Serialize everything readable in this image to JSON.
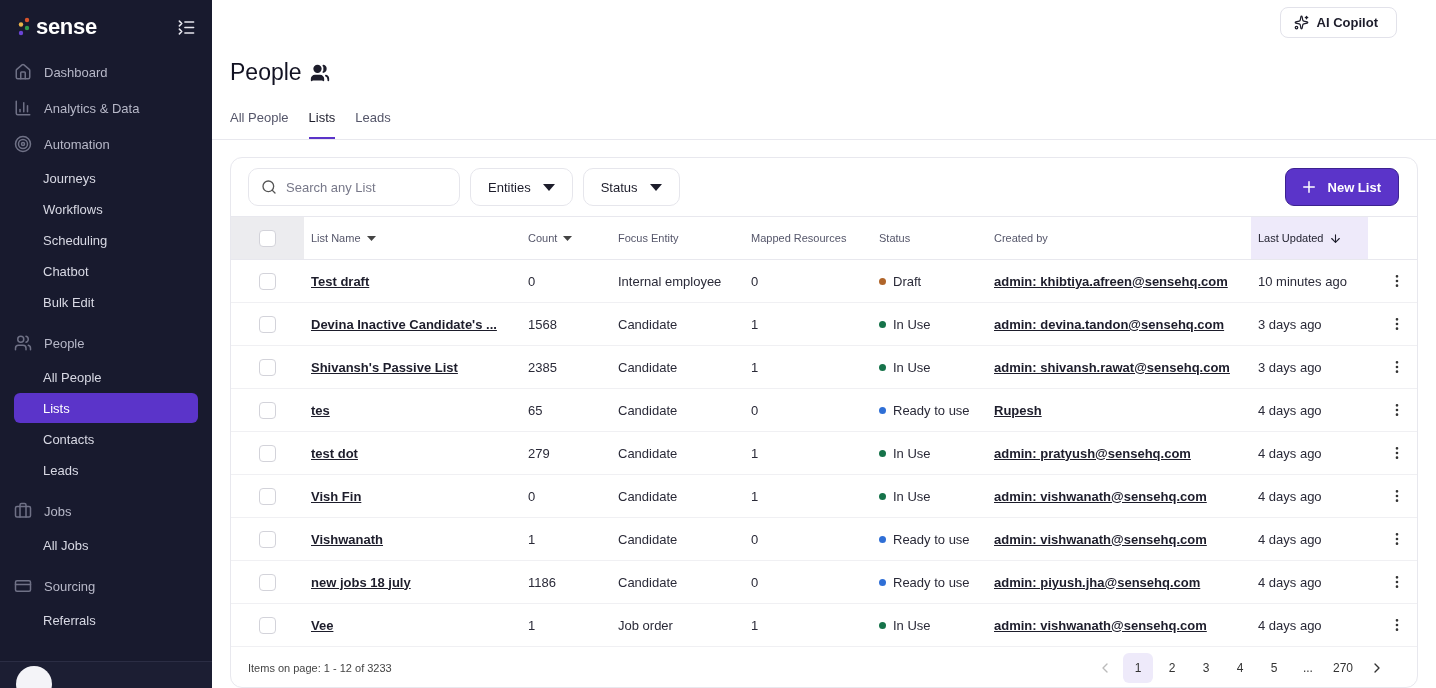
{
  "brand": {
    "name": "sense"
  },
  "sidebar": {
    "sections": [
      {
        "label": "Dashboard"
      },
      {
        "label": "Analytics & Data"
      },
      {
        "label": "Automation",
        "children": [
          {
            "label": "Journeys",
            "selected": false
          },
          {
            "label": "Workflows",
            "selected": false
          },
          {
            "label": "Scheduling",
            "selected": false
          },
          {
            "label": "Chatbot",
            "selected": false
          },
          {
            "label": "Bulk Edit",
            "selected": false
          }
        ]
      },
      {
        "label": "People",
        "children": [
          {
            "label": "All People",
            "selected": false
          },
          {
            "label": "Lists",
            "selected": true
          },
          {
            "label": "Contacts",
            "selected": false
          },
          {
            "label": "Leads",
            "selected": false
          }
        ]
      },
      {
        "label": "Jobs",
        "children": [
          {
            "label": "All Jobs",
            "selected": false
          }
        ]
      },
      {
        "label": "Sourcing",
        "children": [
          {
            "label": "Referrals",
            "selected": false
          }
        ]
      }
    ]
  },
  "copilot": {
    "label": "AI Copilot"
  },
  "page": {
    "title": "People"
  },
  "tabs": [
    {
      "label": "All People",
      "selected": false
    },
    {
      "label": "Lists",
      "selected": true
    },
    {
      "label": "Leads",
      "selected": false
    }
  ],
  "toolbar": {
    "search": {
      "placeholder": "Search any List"
    },
    "filters": [
      "Entities",
      "Status"
    ],
    "new_button": "New List"
  },
  "table": {
    "header_checked": false,
    "columns": [
      {
        "label": "List Name",
        "kind": "menu",
        "selected": false
      },
      {
        "label": "Count",
        "kind": "menu",
        "selected": false
      },
      {
        "label": "Focus Entity",
        "kind": "plain",
        "selected": false
      },
      {
        "label": "Mapped Resources",
        "kind": "plain",
        "selected": false
      },
      {
        "label": "Status",
        "kind": "plain",
        "selected": false
      },
      {
        "label": "Created by",
        "kind": "plain",
        "selected": false
      },
      {
        "label": "Last Updated",
        "kind": "sorted",
        "selected": true
      }
    ],
    "rows": [
      {
        "checked": false,
        "name": "Test draft",
        "count": "0",
        "focus": "Internal employee",
        "mapped": "0",
        "status": "Draft",
        "color": "#b0652a",
        "created_by": "admin: khibtiya.afreen@sensehq.com",
        "updated": "10 minutes ago"
      },
      {
        "checked": false,
        "name": "Devina Inactive Candidate's ...",
        "count": "1568",
        "focus": "Candidate",
        "mapped": "1",
        "status": "In Use",
        "color": "#16734a",
        "created_by": "admin: devina.tandon@sensehq.com",
        "updated": "3 days ago"
      },
      {
        "checked": false,
        "name": "Shivansh's Passive List",
        "count": "2385",
        "focus": "Candidate",
        "mapped": "1",
        "status": "In Use",
        "color": "#16734a",
        "created_by": "admin: shivansh.rawat@sensehq.com",
        "updated": "3 days ago"
      },
      {
        "checked": false,
        "name": "tes",
        "count": "65",
        "focus": "Candidate",
        "mapped": "0",
        "status": "Ready to use",
        "color": "#2f6fd6",
        "created_by": "Rupesh",
        "updated": "4 days ago"
      },
      {
        "checked": false,
        "name": "test dot",
        "count": "279",
        "focus": "Candidate",
        "mapped": "1",
        "status": "In Use",
        "color": "#16734a",
        "created_by": "admin: pratyush@sensehq.com",
        "updated": "4 days ago"
      },
      {
        "checked": false,
        "name": "Vish Fin",
        "count": "0",
        "focus": "Candidate",
        "mapped": "1",
        "status": "In Use",
        "color": "#16734a",
        "created_by": "admin: vishwanath@sensehq.com",
        "updated": "4 days ago"
      },
      {
        "checked": false,
        "name": "Vishwanath",
        "count": "1",
        "focus": "Candidate",
        "mapped": "0",
        "status": "Ready to use",
        "color": "#2f6fd6",
        "created_by": "admin: vishwanath@sensehq.com",
        "updated": "4 days ago"
      },
      {
        "checked": false,
        "name": "new jobs 18 july",
        "count": "1186",
        "focus": "Candidate",
        "mapped": "0",
        "status": "Ready to use",
        "color": "#2f6fd6",
        "created_by": "admin: piyush.jha@sensehq.com",
        "updated": "4 days ago"
      },
      {
        "checked": false,
        "name": "Vee",
        "count": "1",
        "focus": "Job order",
        "mapped": "1",
        "status": "In Use",
        "color": "#16734a",
        "created_by": "admin: vishwanath@sensehq.com",
        "updated": "4 days ago"
      }
    ]
  },
  "pagination": {
    "summary": "Items on page: 1 - 12 of 3233",
    "pages": [
      {
        "label": "1",
        "selected": true
      },
      {
        "label": "2",
        "selected": false
      },
      {
        "label": "3",
        "selected": false
      },
      {
        "label": "4",
        "selected": false
      },
      {
        "label": "5",
        "selected": false
      },
      {
        "label": "...",
        "selected": false
      },
      {
        "label": "270",
        "selected": false
      }
    ]
  }
}
